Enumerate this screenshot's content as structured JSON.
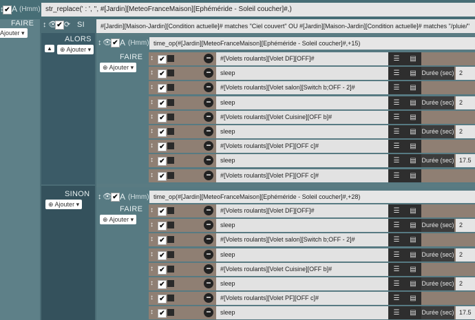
{
  "top": {
    "faire_label": "FAIRE",
    "ajouter_label": "Ajouter",
    "a_label": "A",
    "hmm_label": "(Hmm)",
    "expression": "str_replace(' : ', '', #[Jardin][MeteoFranceMaison][Ephéméride - Soleil coucher]#,)"
  },
  "si": {
    "label": "SI",
    "condition": "#[Jardin][Maison-Jardin][Condition actuelle]# matches \"Ciel couvert\" OU #[Jardin][Maison-Jardin][Condition actuelle]# matches \"/pluie/\""
  },
  "alors": {
    "label": "ALORS",
    "ajouter_label": "Ajouter",
    "a_label": "A",
    "hmm_label": "(Hmm)",
    "expression": "time_op(#[Jardin][MeteoFranceMaison][Ephéméride - Soleil coucher]#,+15)",
    "faire_label": "FAIRE",
    "faire_ajouter": "Ajouter",
    "rows": [
      {
        "text": "#[Volets roulants][Volet DF][OFF]#",
        "duree": "",
        "value": ""
      },
      {
        "text": "sleep",
        "duree": "Durée (sec)",
        "value": "2"
      },
      {
        "text": "#[Volets roulants][Volet salon][Switch b;OFF - 2]#",
        "duree": "",
        "value": ""
      },
      {
        "text": "sleep",
        "duree": "Durée (sec)",
        "value": "2"
      },
      {
        "text": "#[Volets roulants][Volet Cuisine][OFF b]#",
        "duree": "",
        "value": ""
      },
      {
        "text": "sleep",
        "duree": "Durée (sec)",
        "value": "2"
      },
      {
        "text": "#[Volets roulants][Volet PF][OFF c]#",
        "duree": "",
        "value": ""
      },
      {
        "text": "sleep",
        "duree": "Durée (sec)",
        "value": "17.5"
      },
      {
        "text": "#[Volets roulants][Volet PF][OFF c]#",
        "duree": "",
        "value": ""
      }
    ]
  },
  "sinon": {
    "label": "SINON",
    "ajouter_label": "Ajouter",
    "a_label": "A",
    "hmm_label": "(Hmm)",
    "expression": "time_op(#[Jardin][MeteoFranceMaison][Ephéméride - Soleil coucher]#,+28)",
    "faire_label": "FAIRE",
    "faire_ajouter": "Ajouter",
    "rows": [
      {
        "text": "#[Volets roulants][Volet DF][OFF]#",
        "duree": "",
        "value": ""
      },
      {
        "text": "sleep",
        "duree": "Durée (sec)",
        "value": "2"
      },
      {
        "text": "#[Volets roulants][Volet salon][Switch b;OFF - 2]#",
        "duree": "",
        "value": ""
      },
      {
        "text": "sleep",
        "duree": "Durée (sec)",
        "value": "2"
      },
      {
        "text": "#[Volets roulants][Volet Cuisine][OFF b]#",
        "duree": "",
        "value": ""
      },
      {
        "text": "sleep",
        "duree": "Durée (sec)",
        "value": "2"
      },
      {
        "text": "#[Volets roulants][Volet PF][OFF c]#",
        "duree": "",
        "value": ""
      },
      {
        "text": "sleep",
        "duree": "Durée (sec)",
        "value": "17.5"
      }
    ]
  }
}
